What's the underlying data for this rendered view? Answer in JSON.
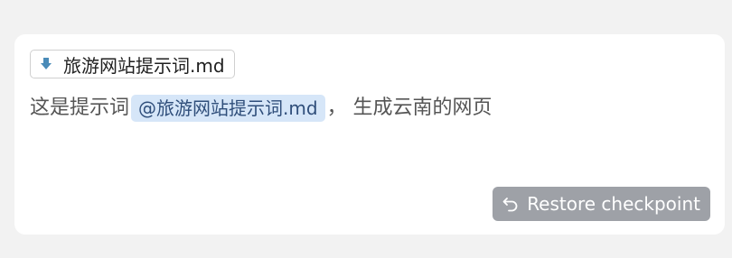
{
  "attachment": {
    "icon": "download-arrow-icon",
    "icon_color": "#4a8bb8",
    "file_name": "旅游网站提示词.md"
  },
  "message": {
    "prefix": "这是提示词",
    "mention": "@旅游网站提示词.md",
    "suffix": "，  生成云南的网页"
  },
  "actions": {
    "restore_icon": "undo-arrow-icon",
    "restore_label": "Restore checkpoint"
  }
}
